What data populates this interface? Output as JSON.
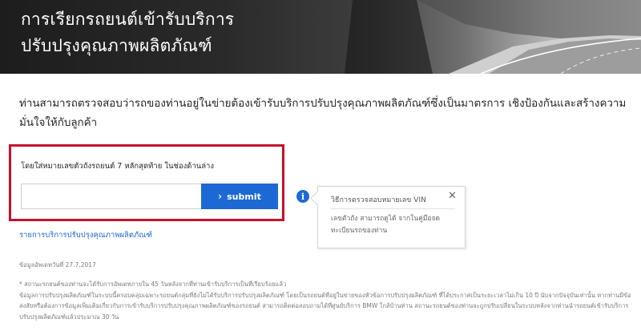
{
  "hero": {
    "title_line1": "การเรียกรถยนต์เข้ารับบริการ",
    "title_line2": "ปรับปรุงคุณภาพผลิตภัณฑ์"
  },
  "intro": "ท่านสามารถตรวจสอบว่ารถของท่านอยู่ในข่ายต้องเข้ารับบริการปรับปรุงคุณภาพผลิตภัณฑ์ซึ่งเป็นมาตรการ เชิงป้องกันและสร้างความมั่นใจให้กับลูกค้า",
  "vin_form": {
    "label": "โดยใส่หมายเลขตัวถังรถยนต์ 7 หลักสุดท้าย ในช่องด้านล่าง",
    "input_value": "",
    "submit_label": "submit"
  },
  "info_icon_glyph": "i",
  "tooltip": {
    "title": "วิธีการตรวจสอบหมายเลข VIN",
    "close_glyph": "✕",
    "body": "เลขตัวถัง สามารถดูได้ จากในคู่มือจด ทะเบียนรถของท่าน"
  },
  "report_link": "รายการบริการปรับปรุงคุณภาพผลิตภัณฑ์",
  "updated": "ข้อมูลอัพเดทวันที่ 27.7.2017",
  "footnote": {
    "line1": "* สถานะรถยนต์ของท่านจะได้รับการอัพเดทภายใน 45 วันหลังจากที่ท่านเข้ารับบริการเป็นที่เรียบร้อยแล้ว",
    "line2": "ข้อมูลการปรับปรุงผลิตภัณฑ์ในระบบนี้ครอบคลุมเฉพาะรถยนต์กลุ่มที่ยังไม่ได้รับบริการปรับปรุงผลิตภัณฑ์ โดยเป็นรถยนต์ที่อยู่ในข่ายของหัวข้อการปรับปรุงผลิตภัณฑ์ ที่ได้ประกาศเป็นระยะเวลาไม่เกิน 10 ปี นับจากปัจจุบันเท่านั้น หากท่านมีข้อสงสัยหรือต้องการข้อมูลเพิ่มเติมเกี่ยวกับการเข้ารับบริการปรับปรุงคุณภาพผลิตภัณฑ์ของรถยนต์ สามารถติดต่อสอบถามได้ที่ศูนย์บริการ BMW ใกล้บ้านท่าน สถานะรถยนต์ของท่านจะถูกปรับเปลี่ยนในระบบหลังจากท่านนำรถยนต์เข้ารับบริการปรับปรุงผลิตภัณฑ์แล้วประมาณ 30 วัน"
  },
  "colors": {
    "accent_blue": "#1c69d4",
    "highlight_red": "#c8102e"
  }
}
